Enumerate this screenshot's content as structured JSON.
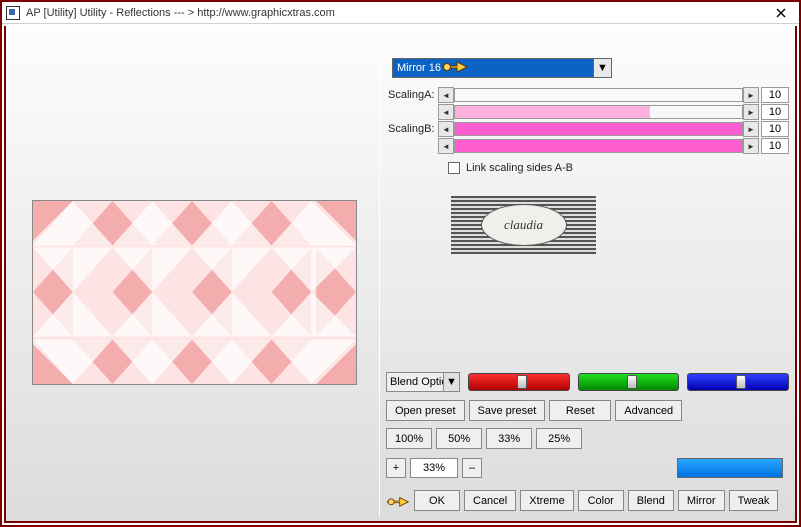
{
  "window": {
    "title": "AP [Utility]  Utility - Reflections    --- > http://www.graphicxtras.com"
  },
  "mode_dropdown": {
    "selected": "Mirror 16"
  },
  "sliders": {
    "scalingA_label": "ScalingA:",
    "scalingB_label": "ScalingB:",
    "rows": [
      {
        "value": "10",
        "fill_pct": 0,
        "color": "#ffcde4"
      },
      {
        "value": "10",
        "fill_pct": 68,
        "color": "#ffb0df"
      },
      {
        "value": "10",
        "fill_pct": 100,
        "color": "#ff5ed0"
      },
      {
        "value": "10",
        "fill_pct": 100,
        "color": "#ff5ed0"
      }
    ],
    "link_label": "Link scaling sides A-B"
  },
  "logo_text": "claudia",
  "blend": {
    "label": "Blend Optio"
  },
  "preset_buttons": {
    "open": "Open preset",
    "save": "Save preset",
    "reset": "Reset",
    "advanced": "Advanced"
  },
  "pct_buttons": {
    "p100": "100%",
    "p50": "50%",
    "p33": "33%",
    "p25": "25%"
  },
  "spinner": {
    "plus": "+",
    "value": "33%",
    "minus": "–"
  },
  "bottom": {
    "ok": "OK",
    "cancel": "Cancel",
    "xtreme": "Xtreme",
    "color": "Color",
    "blend": "Blend",
    "mirror": "Mirror",
    "tweak": "Tweak"
  }
}
